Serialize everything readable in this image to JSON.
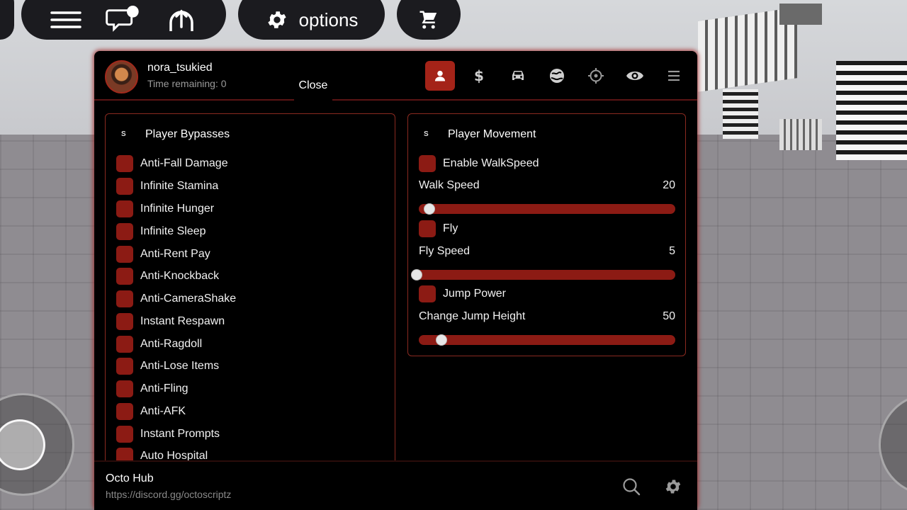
{
  "toolbar": {
    "options_label": "options"
  },
  "user": {
    "name": "nora_tsukied",
    "time_remaining": "Time remaining: 0"
  },
  "close_label": "Close",
  "nav_tabs": [
    {
      "icon": "person-icon",
      "active": true
    },
    {
      "icon": "dollar-icon",
      "active": false
    },
    {
      "icon": "car-icon",
      "active": false
    },
    {
      "icon": "globe-icon",
      "active": false
    },
    {
      "icon": "crosshair-icon",
      "active": false
    },
    {
      "icon": "eye-icon",
      "active": false
    },
    {
      "icon": "list-icon",
      "active": false
    }
  ],
  "bypasses": {
    "title": "Player Bypasses",
    "items": [
      "Anti-Fall Damage",
      "Infinite Stamina",
      "Infinite Hunger",
      "Infinite Sleep",
      "Anti-Rent Pay",
      "Anti-Knockback",
      "Anti-CameraShake",
      "Instant Respawn",
      "Anti-Ragdoll",
      "Anti-Lose Items",
      "Anti-Fling",
      "Anti-AFK",
      "Instant Prompts",
      "Auto Hospital"
    ]
  },
  "movement": {
    "title": "Player Movement",
    "walkspeed_toggle": "Enable WalkSpeed",
    "walk_speed_label": "Walk Speed",
    "walk_speed_value": "20",
    "walk_speed_fraction": 0.02,
    "fly_toggle": "Fly",
    "fly_speed_label": "Fly Speed",
    "fly_speed_value": "5",
    "fly_speed_fraction": 0.0,
    "jump_toggle": "Jump Power",
    "jump_height_label": "Change Jump Height",
    "jump_height_value": "50",
    "jump_height_fraction": 0.07
  },
  "footer": {
    "hub_name": "Octo Hub",
    "link": "https://discord.gg/octoscriptz"
  },
  "colors": {
    "accent": "#a42318",
    "toggle": "#8c1b14",
    "panel_bg": "#000000"
  }
}
